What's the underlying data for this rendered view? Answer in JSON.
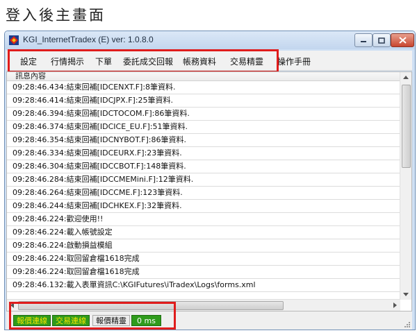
{
  "caption": "登入後主畫面",
  "window": {
    "title": "KGI_InternetTradex (E) ver: 1.0.8.0"
  },
  "menu": {
    "items": [
      "設定",
      "行情揭示",
      "下單",
      "委託成交回報",
      "帳務資料",
      "交易精靈",
      "操作手冊"
    ]
  },
  "log": {
    "header": "訊息內容",
    "rows": [
      "09:28:46.434:結束回補[IDCENXT.F]:8筆資料.",
      "09:28:46.414:結束回補[IDCJPX.F]:25筆資料.",
      "09:28:46.394:結束回補[IDCTOCOM.F]:86筆資料.",
      "09:28:46.374:結束回補[IDCICE_EU.F]:51筆資料.",
      "09:28:46.354:結束回補[IDCNYBOT.F]:86筆資料.",
      "09:28:46.334:結束回補[IDCEURX.F]:23筆資料.",
      "09:28:46.304:結束回補[IDCCBOT.F]:148筆資料.",
      "09:28:46.284:結束回補[IDCCMEMini.F]:12筆資料.",
      "09:28:46.264:結束回補[IDCCME.F]:123筆資料.",
      "09:28:46.244:結束回補[IDCHKEX.F]:32筆資料.",
      "09:28:46.224:歡迎使用!!",
      "09:28:46.224:載入帳號設定",
      "09:28:46.224:啟動損益模組",
      "09:28:46.224:取回留倉檔1618完成",
      "09:28:46.224:取回留倉檔1618完成",
      "09:28:46.132:載入表單資訊C:\\KGIFutures\\iTradex\\Logs\\forms.xml"
    ]
  },
  "status": {
    "quote_connection": "報價連線",
    "trade_connection": "交易連線",
    "quote_wizard": "報價精靈",
    "latency": "0 ms"
  },
  "colors": {
    "highlight": "#e01c1c",
    "status_green": "#2f9b1c",
    "status_text": "#f2e400"
  }
}
